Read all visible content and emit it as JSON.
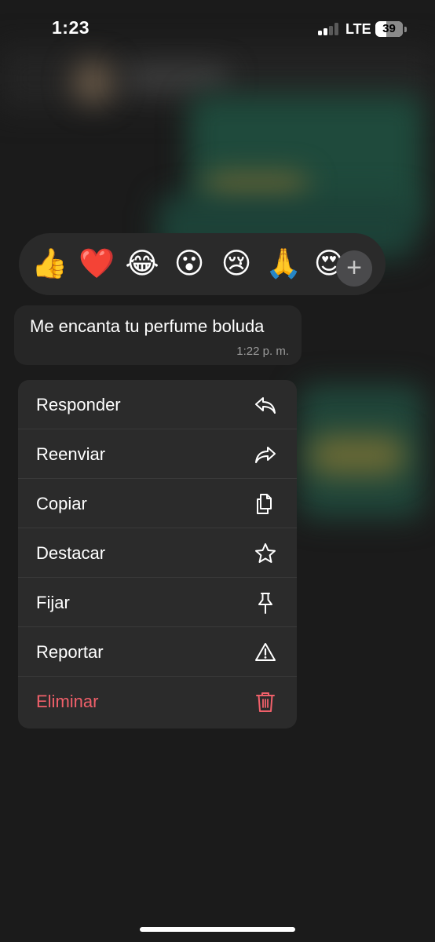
{
  "status_bar": {
    "time": "1:23",
    "network": "LTE",
    "battery": "39",
    "battery_level_percent": 39
  },
  "reactions": {
    "emojis": [
      {
        "name": "thumbs-up",
        "char": "👍"
      },
      {
        "name": "red-heart",
        "char": "❤️"
      },
      {
        "name": "tears-of-joy",
        "char": "😂"
      },
      {
        "name": "surprised",
        "char": "😮"
      },
      {
        "name": "crying",
        "char": "😢"
      },
      {
        "name": "folded-hands",
        "char": "🙏"
      },
      {
        "name": "heart-eyes",
        "char": "😍"
      }
    ],
    "more_icon": "plus-icon",
    "more_symbol": "+"
  },
  "message": {
    "text": "Me encanta tu perfume boluda",
    "time": "1:22 p. m."
  },
  "menu": {
    "items": [
      {
        "label": "Responder",
        "icon": "reply-icon"
      },
      {
        "label": "Reenviar",
        "icon": "forward-icon"
      },
      {
        "label": "Copiar",
        "icon": "copy-icon"
      },
      {
        "label": "Destacar",
        "icon": "star-icon"
      },
      {
        "label": "Fijar",
        "icon": "pin-icon"
      },
      {
        "label": "Reportar",
        "icon": "warning-icon"
      },
      {
        "label": "Eliminar",
        "icon": "trash-icon",
        "color": "#f0606a"
      }
    ]
  }
}
